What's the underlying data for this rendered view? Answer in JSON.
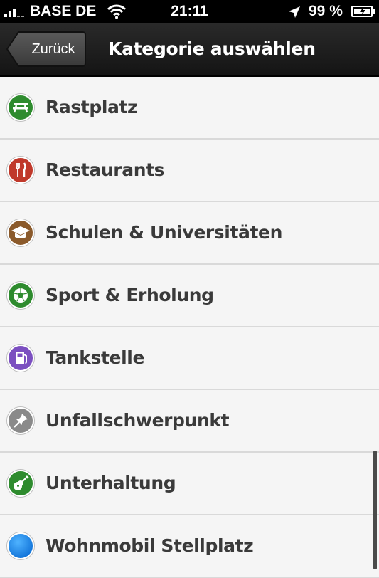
{
  "status_bar": {
    "carrier": "BASE DE",
    "time": "21:11",
    "battery_percent": "99 %"
  },
  "nav": {
    "back_label": "Zurück",
    "title": "Kategorie auswählen"
  },
  "categories": [
    {
      "label": "Rastplatz",
      "icon": "picnic-table-icon",
      "color": "#2e8b2e"
    },
    {
      "label": "Restaurants",
      "icon": "fork-knife-icon",
      "color": "#c0392b"
    },
    {
      "label": "Schulen & Universitäten",
      "icon": "graduation-cap-icon",
      "color": "#8b5a2b"
    },
    {
      "label": "Sport & Erholung",
      "icon": "soccer-ball-icon",
      "color": "#2e8b2e"
    },
    {
      "label": "Tankstelle",
      "icon": "fuel-pump-icon",
      "color": "#7b4fc0"
    },
    {
      "label": "Unfallschwerpunkt",
      "icon": "pin-icon",
      "color": "#8a8a8a"
    },
    {
      "label": "Unterhaltung",
      "icon": "guitar-icon",
      "color": "#2e8b2e"
    },
    {
      "label": "Wohnmobil Stellplatz",
      "icon": "blue-dot-icon",
      "color": "#1e88e5"
    }
  ]
}
